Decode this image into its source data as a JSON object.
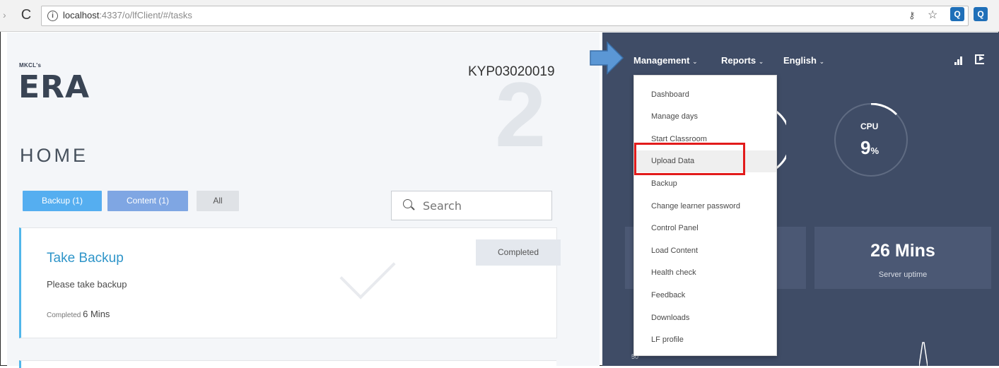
{
  "browser": {
    "url_host": "localhost",
    "url_rest": ":4337/o/lfClient/#/tasks",
    "info_glyph": "i"
  },
  "header": {
    "brand_small": "MKCL's",
    "brand_big": "ERA",
    "center_code": "KYP03020019",
    "big_number": "2"
  },
  "page": {
    "title": "HOME"
  },
  "filters": [
    {
      "label": "Backup (1)"
    },
    {
      "label": "Content (1)"
    },
    {
      "label": "All"
    }
  ],
  "search": {
    "placeholder": "Search"
  },
  "task": {
    "title": "Take Backup",
    "description": "Please take backup",
    "meta_label": "Completed",
    "meta_time": "6 Mins",
    "status": "Completed"
  },
  "topnav": {
    "management": "Management",
    "reports": "Reports",
    "language": "English",
    "chevron": "⌄"
  },
  "menu": {
    "items": [
      "Dashboard",
      "Manage days",
      "Start Classroom",
      "Upload Data",
      "Backup",
      "Change learner password",
      "Control Panel",
      "Load Content",
      "Health check",
      "Feedback",
      "Downloads",
      "LF profile"
    ],
    "highlighted": "Upload Data"
  },
  "cpu": {
    "label": "CPU",
    "value": "9",
    "unit": "%"
  },
  "uptime": {
    "value": "26 Mins",
    "label": "Server uptime"
  },
  "axis_tick": "50",
  "colors": {
    "accent_blue": "#50b6ea",
    "panel_dark": "#3f4c66",
    "highlight_red": "#e21b1b"
  }
}
